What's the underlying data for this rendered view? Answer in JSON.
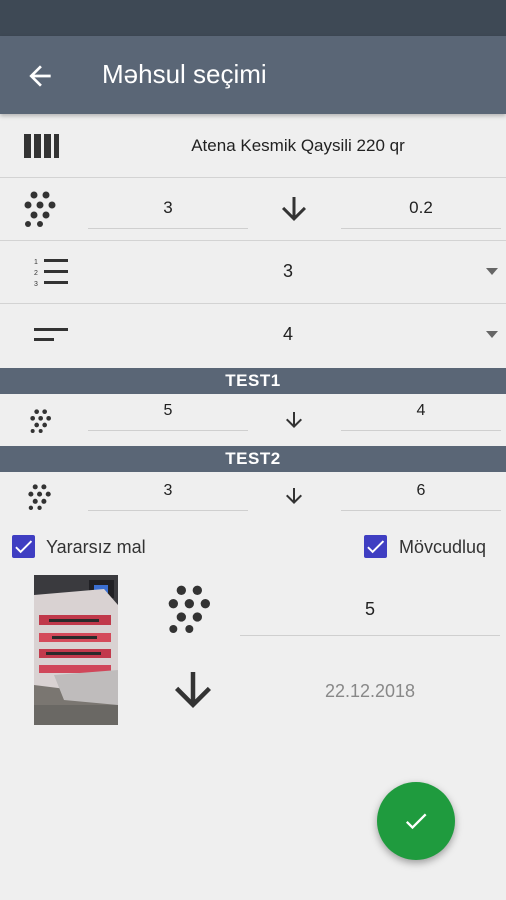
{
  "appbar": {
    "title": "Məhsul seçimi"
  },
  "product": {
    "name": "Atena Kesmik Qaysili 220 qr"
  },
  "quantity_row": {
    "left_value": "3",
    "right_value": "0.2"
  },
  "dropdown1": {
    "value": "3"
  },
  "dropdown2": {
    "value": "4"
  },
  "sections": [
    {
      "title": "TEST1",
      "left_value": "5",
      "right_value": "4"
    },
    {
      "title": "TEST2",
      "left_value": "3",
      "right_value": "6"
    }
  ],
  "checkboxes": {
    "unusable": {
      "label": "Yararsız mal",
      "checked": true
    },
    "availability": {
      "label": "Mövcudluq",
      "checked": true
    }
  },
  "detail": {
    "count": "5",
    "date": "22.12.2018"
  },
  "colors": {
    "appbar": "#5a6676",
    "statusbar": "#3e4955",
    "fab": "#1f9b3e",
    "checkbox": "#3f3ec2"
  },
  "icons": {
    "back": "arrow-left-icon",
    "barcode": "barcode-icon",
    "dots": "dots-grid-icon",
    "arrow_down": "arrow-down-icon",
    "numbered_list": "numbered-list-icon",
    "sort_lines": "sort-lines-icon",
    "check": "check-icon"
  }
}
